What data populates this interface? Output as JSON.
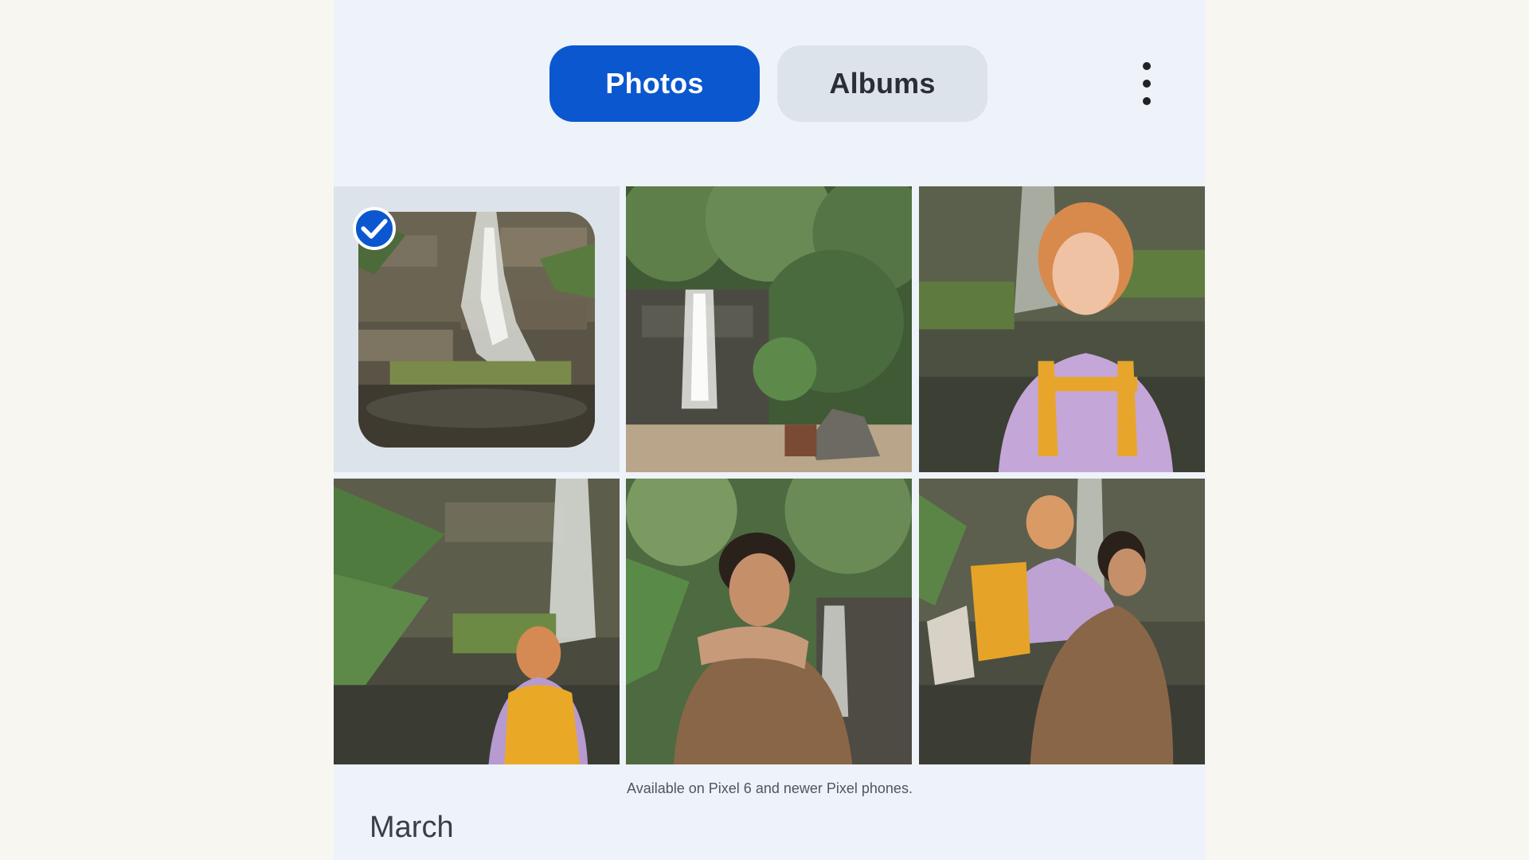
{
  "tabs": {
    "photos": "Photos",
    "albums": "Albums"
  },
  "menu_icon": "more-vert-icon",
  "grid": {
    "selected_index": 0,
    "photos": [
      "waterfall-photo",
      "garden-waterfall-photo",
      "woman-portrait-photo",
      "woman-back-photo",
      "man-laughing-photo",
      "piggyback-photo"
    ]
  },
  "caption": "Available on Pixel 6 and newer Pixel phones.",
  "section_title": "March",
  "colors": {
    "accent": "#0b57d0",
    "surface": "#eef2f9",
    "tab_inactive": "#dde3ea",
    "page_bg": "#f8f6f1"
  }
}
